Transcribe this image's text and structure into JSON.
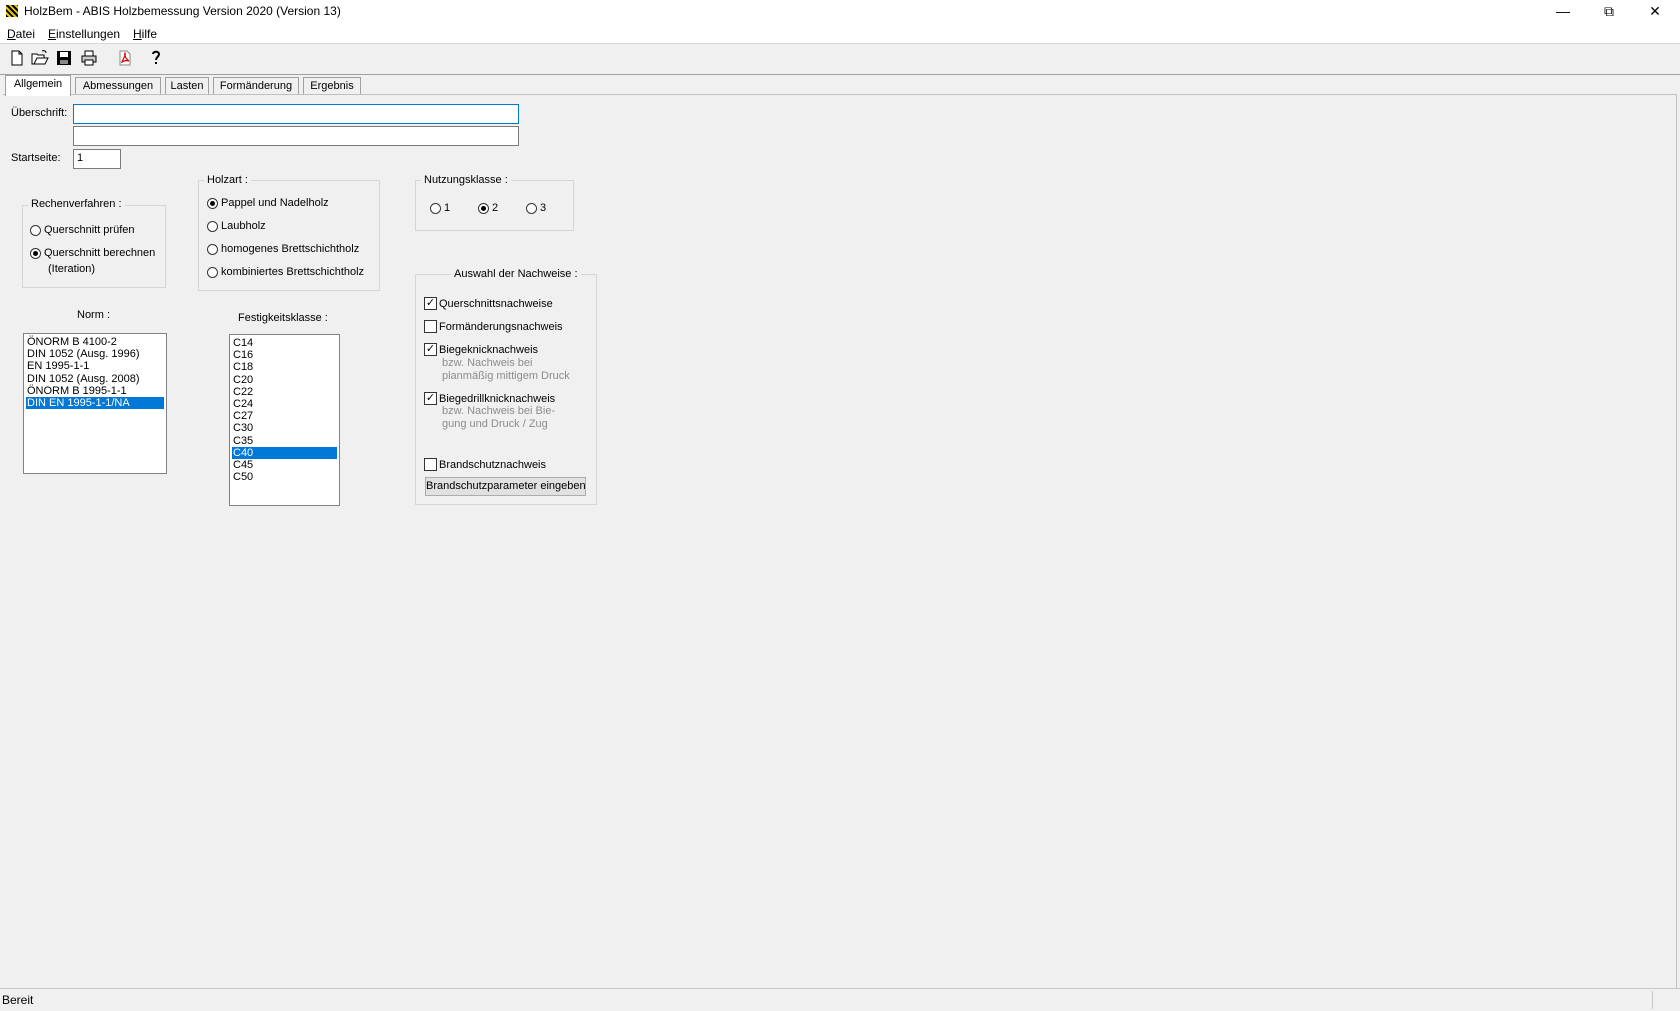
{
  "window": {
    "title": "HolzBem - ABIS Holzbemessung Version 2020 (Version 13)"
  },
  "menu": [
    {
      "label": "Datei",
      "key": "D"
    },
    {
      "label": "Einstellungen",
      "key": "E"
    },
    {
      "label": "Hilfe",
      "key": "H"
    }
  ],
  "toolbar": [
    "new-document-icon",
    "open-folder-icon",
    "save-icon",
    "print-icon",
    "pdf-icon",
    "help-icon"
  ],
  "tabs": [
    "Allgemein",
    "Abmessungen",
    "Lasten",
    "Formänderung",
    "Ergebnis"
  ],
  "active_tab": "Allgemein",
  "form": {
    "ueberschrift_label": "Überschrift:",
    "ueberschrift_line1": "",
    "ueberschrift_line2": "",
    "startseite_label": "Startseite:",
    "startseite_value": "1"
  },
  "rechenverfahren": {
    "title": "Rechenverfahren :",
    "options": [
      "Querschnitt prüfen",
      "Querschnitt berechnen"
    ],
    "option2_sub": "(Iteration)",
    "selected": 1
  },
  "holzart": {
    "title": "Holzart :",
    "options": [
      "Pappel und Nadelholz",
      "Laubholz",
      "homogenes Brettschichtholz",
      "kombiniertes Brettschichtholz"
    ],
    "selected": 0
  },
  "nutzungsklasse": {
    "title": "Nutzungsklasse :",
    "options": [
      "1",
      "2",
      "3"
    ],
    "selected": 1
  },
  "norm": {
    "title": "Norm :",
    "items": [
      "ÖNORM B 4100-2",
      "DIN 1052 (Ausg. 1996)",
      "EN 1995-1-1",
      "DIN 1052 (Ausg. 2008)",
      "ÖNORM B 1995-1-1",
      "DIN EN 1995-1-1/NA"
    ],
    "selected": 5
  },
  "festigkeitsklasse": {
    "title": "Festigkeitsklasse :",
    "items": [
      "C14",
      "C16",
      "C18",
      "C20",
      "C22",
      "C24",
      "C27",
      "C30",
      "C35",
      "C40",
      "C45",
      "C50"
    ],
    "selected": 9
  },
  "nachweise": {
    "title": "Auswahl der Nachweise :",
    "querschnitt": {
      "label": "Querschnittsnachweise",
      "checked": true
    },
    "formaenderung": {
      "label": "Formänderungsnachweis",
      "checked": false
    },
    "biegeknick": {
      "label": "Biegeknicknachweis",
      "checked": true,
      "note1": "bzw. Nachweis bei",
      "note2": "planmäßig mittigem Druck"
    },
    "biegedrillknick": {
      "label": "Biegedrillknicknachweis",
      "checked": true,
      "note1": "bzw. Nachweis bei Bie-",
      "note2": "gung und Druck / Zug"
    },
    "brandschutz": {
      "label": "Brandschutznachweis",
      "checked": false
    },
    "button": "Brandschutzparameter eingeben"
  },
  "status": {
    "text": "Bereit"
  }
}
